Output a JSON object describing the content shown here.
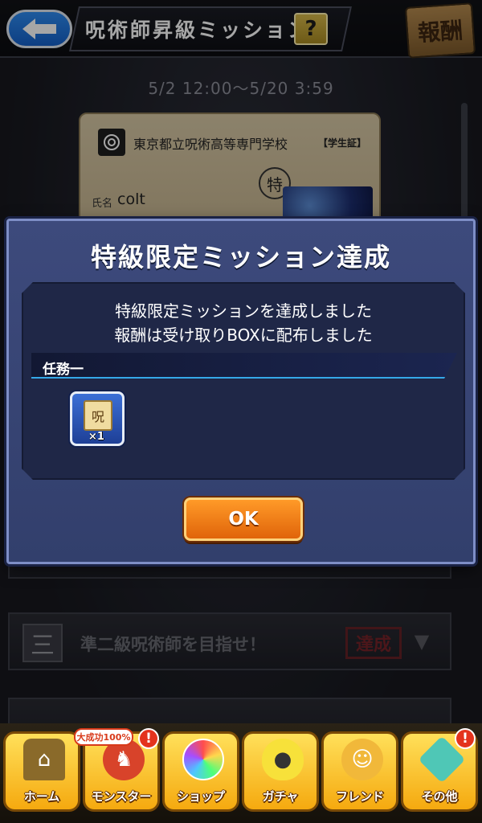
{
  "header": {
    "title": "呪術師昇級ミッション",
    "help_label": "?",
    "reward_label": "報酬"
  },
  "period": "5/2 12:00〜5/20 3:59",
  "student_card": {
    "school": "東京都立呪術高等専門学校",
    "tag": "【学生証】",
    "rank_mark": "特",
    "name_label": "氏名",
    "name": "colt"
  },
  "missions": [
    {
      "number": "三",
      "title": "準二級呪術師を目指せ！",
      "stamp": "達成"
    }
  ],
  "modal": {
    "title": "特級限定ミッション達成",
    "message_line1": "特級限定ミッションを達成しました",
    "message_line2": "報酬は受け取りBOXに配布しました",
    "section_label": "任務一",
    "reward": {
      "icon": "scroll-icon",
      "glyph": "呪",
      "quantity": "×1"
    },
    "ok_label": "OK"
  },
  "bottom_nav": {
    "items": [
      {
        "label": "ホーム",
        "icon": "home-icon"
      },
      {
        "label": "モンスター",
        "icon": "monster-icon",
        "promo": "大成功100%",
        "alert": "!"
      },
      {
        "label": "ショップ",
        "icon": "orb-icon"
      },
      {
        "label": "ガチャ",
        "icon": "egg-icon"
      },
      {
        "label": "フレンド",
        "icon": "friends-icon"
      },
      {
        "label": "その他",
        "icon": "other-icon",
        "alert": "!"
      }
    ]
  },
  "colors": {
    "modal_bg": "#3d4a7c",
    "ok_button": "#ff9a28",
    "nav_button": "#ffe05a",
    "back_button": "#2d8bf0"
  }
}
